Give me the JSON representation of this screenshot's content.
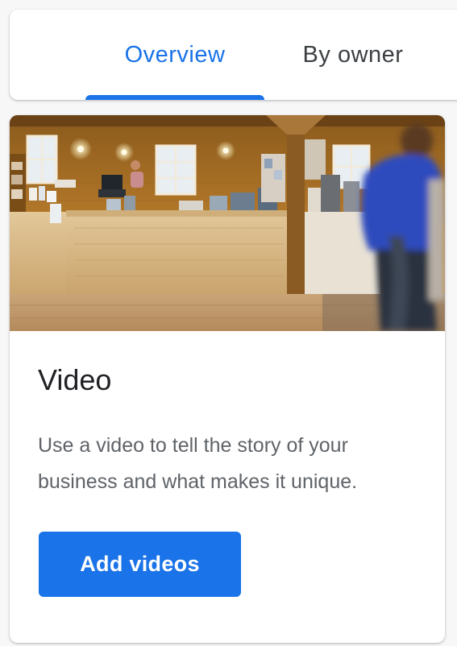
{
  "tabs": [
    {
      "label": "Overview",
      "selected": true
    },
    {
      "label": "By owner",
      "selected": false
    }
  ],
  "card": {
    "title": "Video",
    "description": "Use a video to tell the story of your business and what makes it unique.",
    "button_label": "Add videos",
    "image_description_icon": "shop-interior-photo"
  },
  "colors": {
    "accent": "#1a73e8",
    "title": "#202124",
    "body": "#5f6368"
  }
}
